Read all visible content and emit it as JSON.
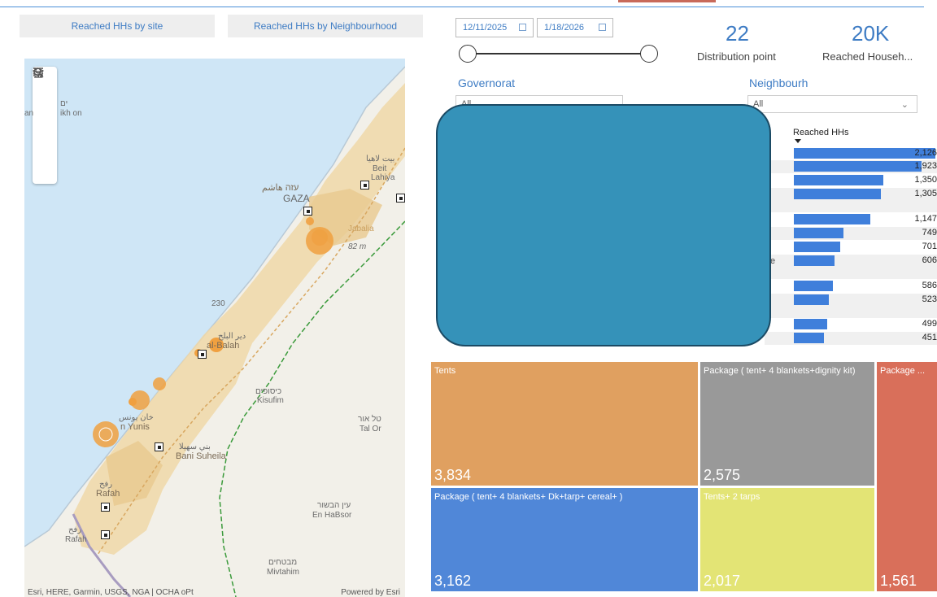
{
  "tabs": {
    "site": "Reached HHs by site",
    "neighbourhood": "Reached HHs by Neighbourhood"
  },
  "dates": {
    "start": "12/11/2025",
    "end": "1/18/2026"
  },
  "kpis": [
    {
      "value": "22",
      "label": "Distribution point"
    },
    {
      "value": "20K",
      "label": "Reached Househ..."
    }
  ],
  "filters": {
    "governorate": {
      "title": "Governorat",
      "value": "All"
    },
    "neighbourhood": {
      "title": "Neighbourh",
      "value": "All"
    }
  },
  "map": {
    "labels": {
      "sea_he": "ים",
      "sea_partial": "ikh on",
      "sea_left": "an",
      "beit_ar": "بيت لاهيا",
      "beit": "Beit",
      "lahiya": "Lahiya",
      "gaza_he": "עזה هاشم",
      "gaza": "GAZA",
      "jabalia": "Jabalia",
      "elev": "82 m",
      "deir_ar": "دير البلح",
      "deir": "al-Balah",
      "kisufim_he": "כיסופים",
      "kisufim": "Kisufim",
      "khan_ar": "خان يونس",
      "khan": "n Yunis",
      "talor_he": "טל אור",
      "talor": "Tal Or",
      "bani_ar": "بني سهيلا",
      "bani": "Bani Suheila",
      "rafah_ar": "رفح",
      "rafah": "Rafah",
      "enhabsor_he": "עין הבשור",
      "enhabsor": "En HaBsor",
      "rafah2_ar": "رفح",
      "rafah2": "Rafah",
      "mivtahim_he": "מבטחים",
      "mivtahim": "Mivtahim",
      "road": "230"
    },
    "attribution": "Esri, HERE, Garmin, USGS, NGA | OCHA oPt",
    "powered": "Powered by Esri",
    "tools": [
      "menu-icon",
      "layers-icon",
      "select-box-icon",
      "search-icon",
      "user-icon"
    ]
  },
  "table": {
    "column_header": "Reached HHs",
    "truncated_label": "e",
    "rows": [
      {
        "value": 2126,
        "label": "2,126"
      },
      {
        "value": 1923,
        "label": "1,923"
      },
      {
        "value": 1350,
        "label": "1,350"
      },
      {
        "value": 1305,
        "label": "1,305"
      },
      {
        "value": 1147,
        "label": "1,147"
      },
      {
        "value": 749,
        "label": "749"
      },
      {
        "value": 701,
        "label": "701"
      },
      {
        "value": 606,
        "label": "606"
      },
      {
        "value": 586,
        "label": "586"
      },
      {
        "value": 523,
        "label": "523"
      },
      {
        "value": 499,
        "label": "499"
      },
      {
        "value": 451,
        "label": "451"
      }
    ]
  },
  "treemap": [
    {
      "label": "Tents",
      "value": "3,834",
      "color": "#e0a060"
    },
    {
      "label": "Package ( tent+ 4 blankets+dignity kit)",
      "value": "2,575",
      "color": "#999999"
    },
    {
      "label": "Package ...",
      "value": "1,561",
      "color": "#d96f5a"
    },
    {
      "label": "Package ( tent+ 4 blankets+ Dk+tarp+ cereal+ )",
      "value": "3,162",
      "color": "#5087d8"
    },
    {
      "label": "Tents+ 2 tarps",
      "value": "2,017",
      "color": "#e3e475"
    }
  ]
}
